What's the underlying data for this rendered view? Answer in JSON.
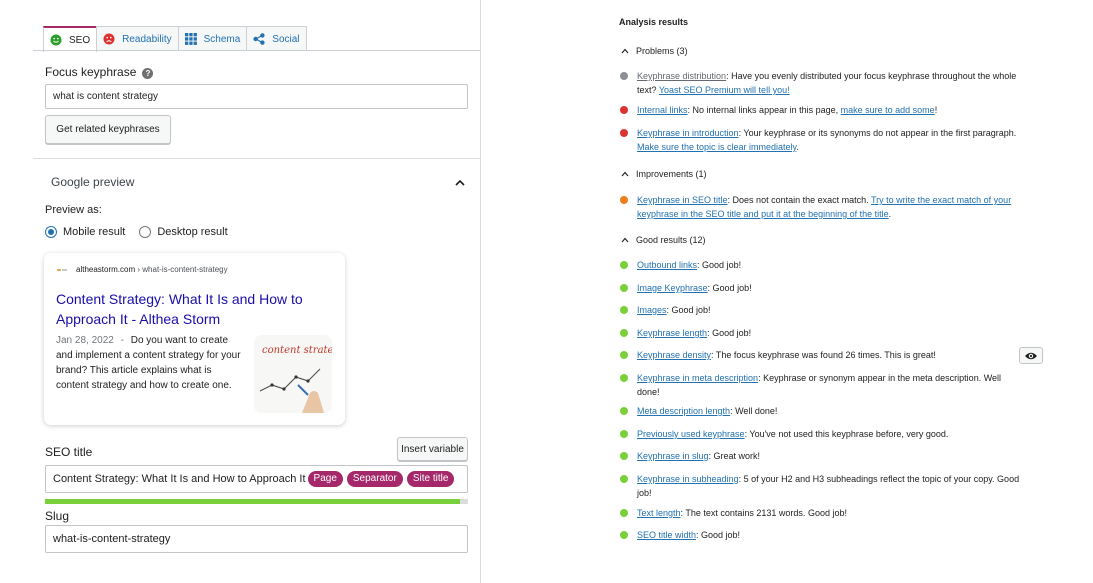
{
  "tabs": [
    {
      "label": "SEO",
      "active": true
    },
    {
      "label": "Readability",
      "active": false
    },
    {
      "label": "Schema",
      "active": false
    },
    {
      "label": "Social",
      "active": false
    }
  ],
  "focus": {
    "label": "Focus keyphrase",
    "value": "what is content strategy",
    "related_button": "Get related keyphrases"
  },
  "google_preview": {
    "heading": "Google preview",
    "preview_as": "Preview as:",
    "mobile_label": "Mobile result",
    "desktop_label": "Desktop result",
    "selected": "mobile",
    "url_host": "altheastorm.com",
    "url_path": "› what-is-content-strategy",
    "title": "Content Strategy: What It Is and How to Approach It - Althea Storm",
    "date": "Jan 28, 2022",
    "date_sep": "-",
    "description": "Do you want to create and implement a content strategy for your brand? This article explains what is content strategy and how to create one.",
    "thumb_text": "content strategy"
  },
  "seo_title": {
    "label": "SEO title",
    "insert_button": "Insert variable",
    "text": "Content Strategy: What It Is and How to Approach It",
    "tags": [
      "Page",
      "Separator",
      "Site title"
    ],
    "progress_percent": 98
  },
  "slug": {
    "label": "Slug",
    "value": "what-is-content-strategy"
  },
  "analysis": {
    "title": "Analysis results",
    "problems_heading": "Problems (3)",
    "improvements_heading": "Improvements (1)",
    "good_heading": "Good results (12)",
    "problems": [
      {
        "link": "Keyphrase distribution",
        "text": ": Have you evenly distributed your focus keyphrase throughout the whole text? ",
        "cta": "Yoast SEO Premium will tell you!",
        "end": "",
        "color": "#8c8f94"
      },
      {
        "link": "Internal links",
        "text": ": No internal links appear in this page, ",
        "cta": "make sure to add some",
        "end": "!",
        "color": "#dc3232"
      },
      {
        "link": "Keyphrase in introduction",
        "text": ": Your keyphrase or its synonyms do not appear in the first paragraph. ",
        "cta": "Make sure the topic is clear immediately",
        "end": ".",
        "color": "#dc3232"
      }
    ],
    "improvements": [
      {
        "link": "Keyphrase in SEO title",
        "text": ": Does not contain the exact match. ",
        "cta": "Try to write the exact match of your keyphrase in the SEO title and put it at the beginning of the title",
        "end": ".",
        "color": "#ee7c1b"
      }
    ],
    "good": [
      {
        "link": "Outbound links",
        "text": ": Good job!"
      },
      {
        "link": "Image Keyphrase",
        "text": ": Good job!"
      },
      {
        "link": "Images",
        "text": ": Good job!"
      },
      {
        "link": "Keyphrase length",
        "text": ": Good job!"
      },
      {
        "link": "Keyphrase density",
        "text": ": The focus keyphrase was found 26 times. This is great!"
      },
      {
        "link": "Keyphrase in meta description",
        "text": ": Keyphrase or synonym appear in the meta description. Well done!"
      },
      {
        "link": "Meta description length",
        "text": ": Well done!"
      },
      {
        "link": "Previously used keyphrase",
        "text": ": You've not used this keyphrase before, very good."
      },
      {
        "link": "Keyphrase in slug",
        "text": ": Great work!"
      },
      {
        "link": "Keyphrase in subheading",
        "text": ": 5 of your H2 and H3 subheadings reflect the topic of your copy. Good job!"
      },
      {
        "link": "Text length",
        "text": ": The text contains 2131 words. Good job!"
      },
      {
        "link": "SEO title width",
        "text": ": Good job!"
      }
    ],
    "good_color": "#7ad03a"
  }
}
